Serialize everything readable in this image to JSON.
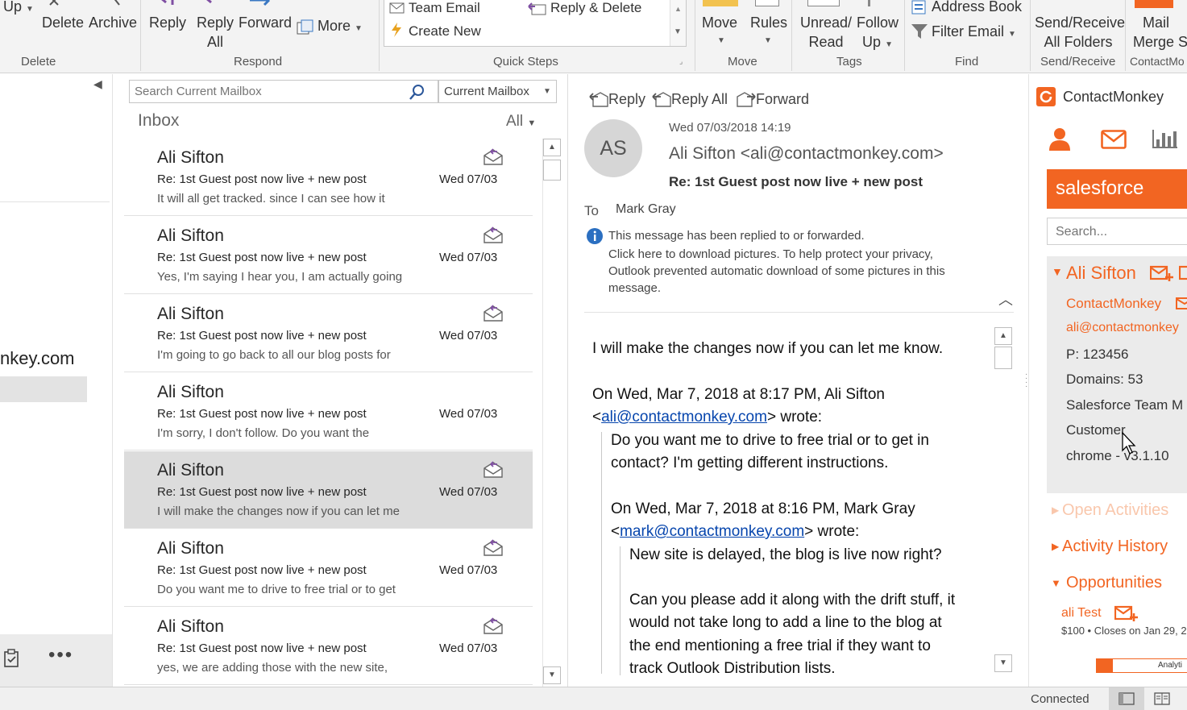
{
  "ribbon": {
    "up_label": "Up",
    "delete_label": "Delete",
    "archive_label": "Archive",
    "reply_label": "Reply",
    "reply_all_label_1": "Reply",
    "reply_all_label_2": "All",
    "forward_label": "Forward",
    "more_label": "More",
    "quick_steps": [
      "Team Email",
      "Create New",
      "Reply & Delete"
    ],
    "move_label": "Move",
    "rules_label": "Rules",
    "unread_read_1": "Unread/",
    "unread_read_2": "Read",
    "follow_up_1": "Follow",
    "follow_up_2": "Up",
    "address_book_label": "Address Book",
    "filter_email_label": "Filter Email",
    "send_receive_1": "Send/Receive",
    "send_receive_2": "All Folders",
    "mail_merge_1": "Mail",
    "mail_merge_2": "Merge S",
    "groups": {
      "delete": "Delete",
      "respond": "Respond",
      "quick_steps": "Quick Steps",
      "move": "Move",
      "tags": "Tags",
      "find": "Find",
      "send_receive": "Send/Receive",
      "contactmonkey": "ContactMo"
    }
  },
  "folder_pane": {
    "email_fragment": "nkey.com"
  },
  "search": {
    "placeholder": "Search Current Mailbox",
    "scope": "Current Mailbox"
  },
  "list": {
    "folder_title": "Inbox",
    "filter_label": "All",
    "messages": [
      {
        "sender": "Ali Sifton",
        "subject": "Re: 1st Guest post now live + new post",
        "date": "Wed 07/03",
        "preview": "It will all get tracked. since I can see how it"
      },
      {
        "sender": "Ali Sifton",
        "subject": "Re: 1st Guest post now live + new post",
        "date": "Wed 07/03",
        "preview": "Yes, I'm saying I hear you, I am actually going"
      },
      {
        "sender": "Ali Sifton",
        "subject": "Re: 1st Guest post now live + new post",
        "date": "Wed 07/03",
        "preview": "I'm going to go back to all our blog posts for"
      },
      {
        "sender": "Ali Sifton",
        "subject": "Re: 1st Guest post now live + new post",
        "date": "Wed 07/03",
        "preview": "I'm sorry, I don't follow.   Do you want the"
      },
      {
        "sender": "Ali Sifton",
        "subject": "Re: 1st Guest post now live + new post",
        "date": "Wed 07/03",
        "preview": "I will make the changes now if you can let me"
      },
      {
        "sender": "Ali Sifton",
        "subject": "Re: 1st Guest post now live + new post",
        "date": "Wed 07/03",
        "preview": "Do you want me to drive to free trial or to get"
      },
      {
        "sender": "Ali Sifton",
        "subject": "Re: 1st Guest post now live + new post",
        "date": "Wed 07/03",
        "preview": "yes, we are adding those with the new site,"
      }
    ]
  },
  "reading": {
    "reply_label": "Reply",
    "reply_all_label": "Reply All",
    "forward_label": "Forward",
    "avatar_initials": "AS",
    "datetime": "Wed 07/03/2018 14:19",
    "from": "Ali Sifton <ali@contactmonkey.com>",
    "subject": "Re: 1st Guest post now live + new post",
    "to_label": "To",
    "to_value": "Mark Gray",
    "info_line1": "This message has been replied to or forwarded.",
    "info_line2": "Click here to download pictures. To help protect your privacy,",
    "info_line3": "Outlook prevented automatic download of some pictures in this",
    "info_line4": "message.",
    "body": {
      "line1": "I will make the changes now if you can let me know.",
      "quote1_header": "On Wed, Mar 7, 2018 at 8:17 PM, Ali Sifton",
      "quote1_lt": "<",
      "quote1_email": "ali@contactmonkey.com",
      "quote1_wrote": "> wrote:",
      "quote1_l1": "Do you want me to drive to free trial or to get in",
      "quote1_l2": "contact? I'm getting different instructions.",
      "quote2_header": "On Wed, Mar 7, 2018 at 8:16 PM, Mark Gray",
      "quote2_lt": "<",
      "quote2_email": "mark@contactmonkey.com",
      "quote2_wrote": "> wrote:",
      "quote2_l1": "New site is delayed, the blog is live now right?",
      "quote2_l2": "Can you please add it along with the drift stuff, it",
      "quote2_l3": "would not take long to add a line to the blog at",
      "quote2_l4": "the end mentioning a free trial if they want to",
      "quote2_l5": "track Outlook Distribution lists."
    }
  },
  "crm": {
    "title": "ContactMonkey",
    "salesforce_label": "salesforce",
    "search_placeholder": "Search...",
    "contact_name": "Ali Sifton",
    "company": "ContactMonkey",
    "email": "ali@contactmonkey",
    "phone": "P: 123456",
    "domains": "Domains: 53",
    "team": "Salesforce Team M",
    "type": "Customer",
    "version": "chrome - v3.1.10",
    "open_activities": "Open Activities",
    "activity_history": "Activity History",
    "opportunities": "Opportunities",
    "opp_name": "ali Test",
    "opp_detail": "$100 • Closes on Jan 29, 2",
    "analytics_label": "Analyti"
  },
  "statusbar": {
    "status": "Connected"
  },
  "colors": {
    "accent_blue": "#2b579a",
    "contactmonkey_orange": "#f26522",
    "selected_row": "#dcdcdc"
  }
}
